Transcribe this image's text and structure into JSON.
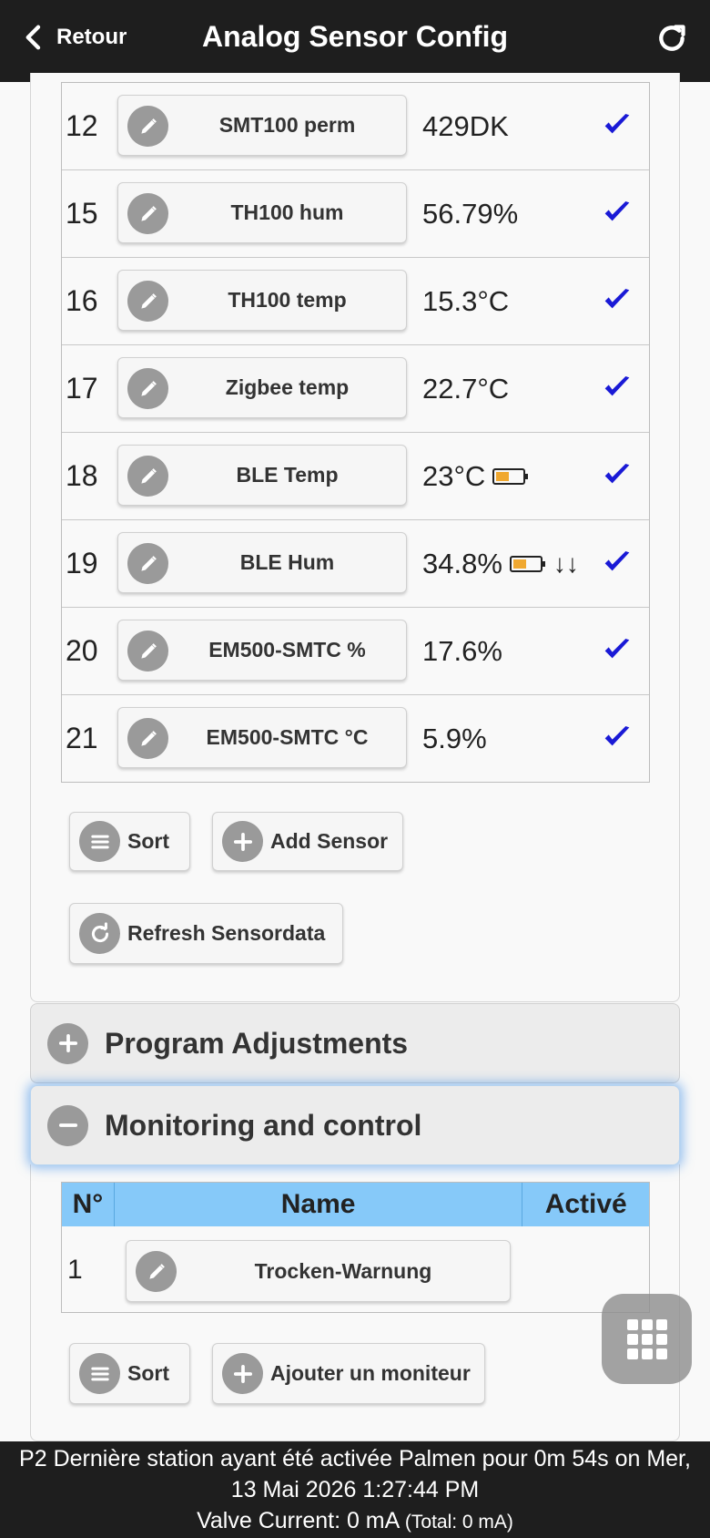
{
  "header": {
    "back_label": "Retour",
    "title": "Analog Sensor Config"
  },
  "sensors": [
    {
      "num": "12",
      "name": "SMT100 perm",
      "value": "429DK",
      "battery": false,
      "arrows": ""
    },
    {
      "num": "15",
      "name": "TH100 hum",
      "value": "56.79%",
      "battery": false,
      "arrows": ""
    },
    {
      "num": "16",
      "name": "TH100 temp",
      "value": "15.3°C",
      "battery": false,
      "arrows": ""
    },
    {
      "num": "17",
      "name": "Zigbee temp",
      "value": "22.7°C",
      "battery": false,
      "arrows": ""
    },
    {
      "num": "18",
      "name": "BLE Temp",
      "value": "23°C",
      "battery": true,
      "arrows": ""
    },
    {
      "num": "19",
      "name": "BLE Hum",
      "value": "34.8%",
      "battery": true,
      "arrows": "↓↓"
    },
    {
      "num": "20",
      "name": "EM500-SMTC %",
      "value": "17.6%",
      "battery": false,
      "arrows": ""
    },
    {
      "num": "21",
      "name": "EM500-SMTC °C",
      "value": "5.9%",
      "battery": false,
      "arrows": ""
    }
  ],
  "sensor_buttons": {
    "sort": "Sort",
    "add_sensor": "Add Sensor",
    "refresh": "Refresh Sensordata"
  },
  "sections": {
    "program_adjustments": "Program Adjustments",
    "monitoring": "Monitoring and control"
  },
  "monitor_table": {
    "headers": [
      "N°",
      "Name",
      "Activé"
    ],
    "rows": [
      {
        "num": "1",
        "name": "Trocken-Warnung"
      }
    ]
  },
  "monitor_buttons": {
    "sort": "Sort",
    "add_monitor": "Ajouter un moniteur"
  },
  "footer": {
    "line1": "P2 Dernière station ayant été activée Palmen pour 0m 54s on Mer,",
    "line2": "13 Mai 2026 1:27:44 PM",
    "line3_main": "Valve Current: 0 mA",
    "line3_small": "(Total: 0 mA)"
  },
  "colors": {
    "header_bg": "#1e1e1e",
    "table_header_bg": "#86c9f9",
    "check": "#1a1ad6",
    "battery_fill": "#f0a830"
  }
}
